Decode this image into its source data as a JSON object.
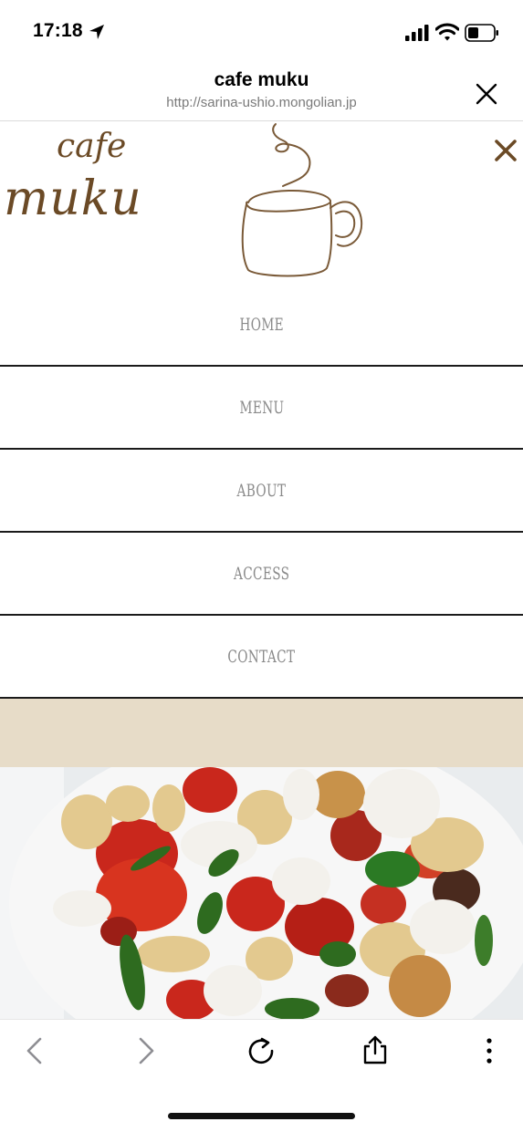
{
  "status_bar": {
    "time": "17:18"
  },
  "browser": {
    "title": "cafe muku",
    "url": "http://sarina-ushio.mongolian.jp"
  },
  "site": {
    "logo_line1": "cafe",
    "logo_line2": "muku",
    "brand_color": "#6b4a26",
    "band_color": "#e7dcc8"
  },
  "menu": {
    "items": [
      {
        "label": "HOME"
      },
      {
        "label": "MENU"
      },
      {
        "label": "ABOUT"
      },
      {
        "label": "ACCESS"
      },
      {
        "label": "CONTACT"
      }
    ]
  },
  "icons": {
    "status": [
      "location-arrow-icon",
      "signal-icon",
      "wifi-icon",
      "battery-icon"
    ],
    "toolbar": [
      "back-icon",
      "forward-icon",
      "reload-icon",
      "share-icon",
      "more-icon"
    ],
    "close": [
      "close-icon",
      "menu-close-icon"
    ]
  }
}
